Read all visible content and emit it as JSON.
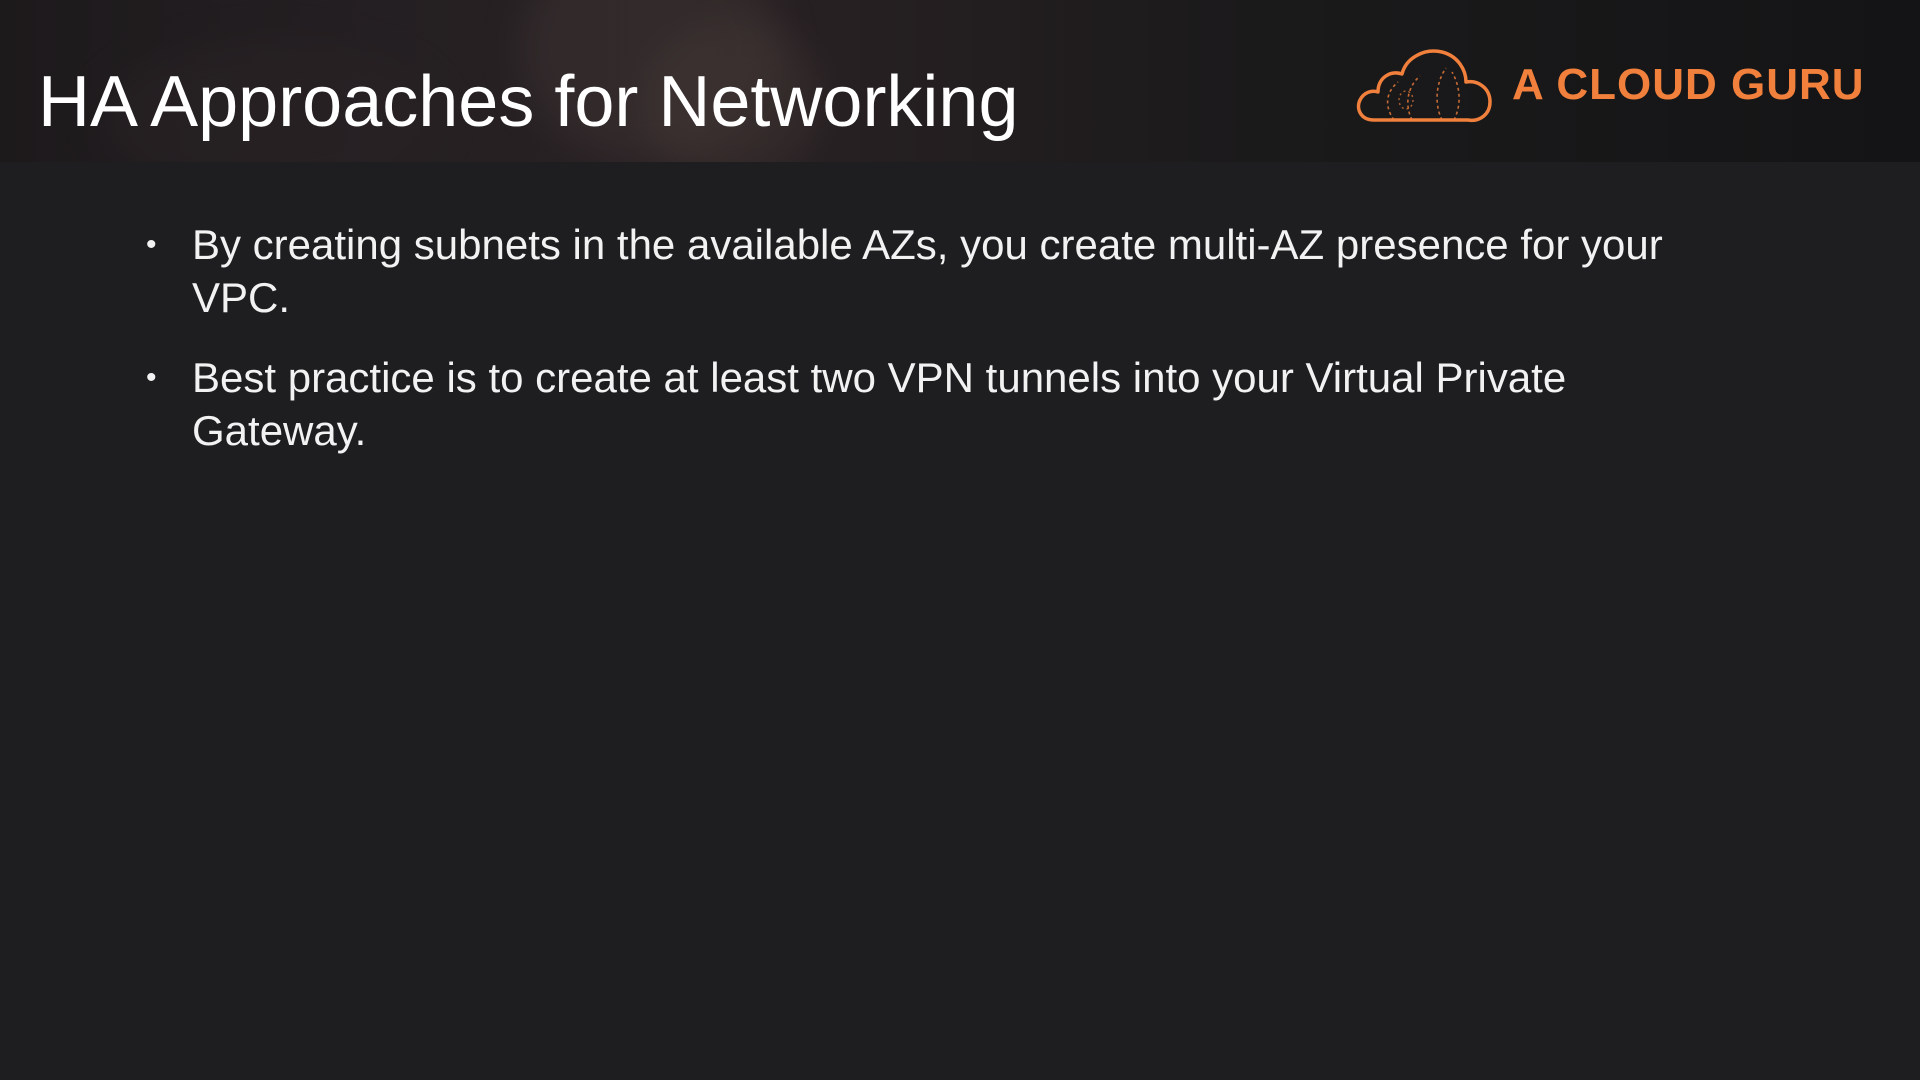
{
  "slide": {
    "title": "HA Approaches for Networking",
    "logo": {
      "text": "A CLOUD GURU",
      "icon": "cloud-logo-icon",
      "color": "#f0803c"
    },
    "bullets": [
      {
        "text": "By creating subnets in the available AZs, you create multi-AZ presence for your VPC."
      },
      {
        "text": "Best practice is to create at least two VPN tunnels into your Virtual Private Gateway."
      }
    ],
    "bullet_glyph": "•"
  },
  "colors": {
    "background": "#1e1d20",
    "text": "#f2f2f2",
    "accent": "#f0803c"
  }
}
